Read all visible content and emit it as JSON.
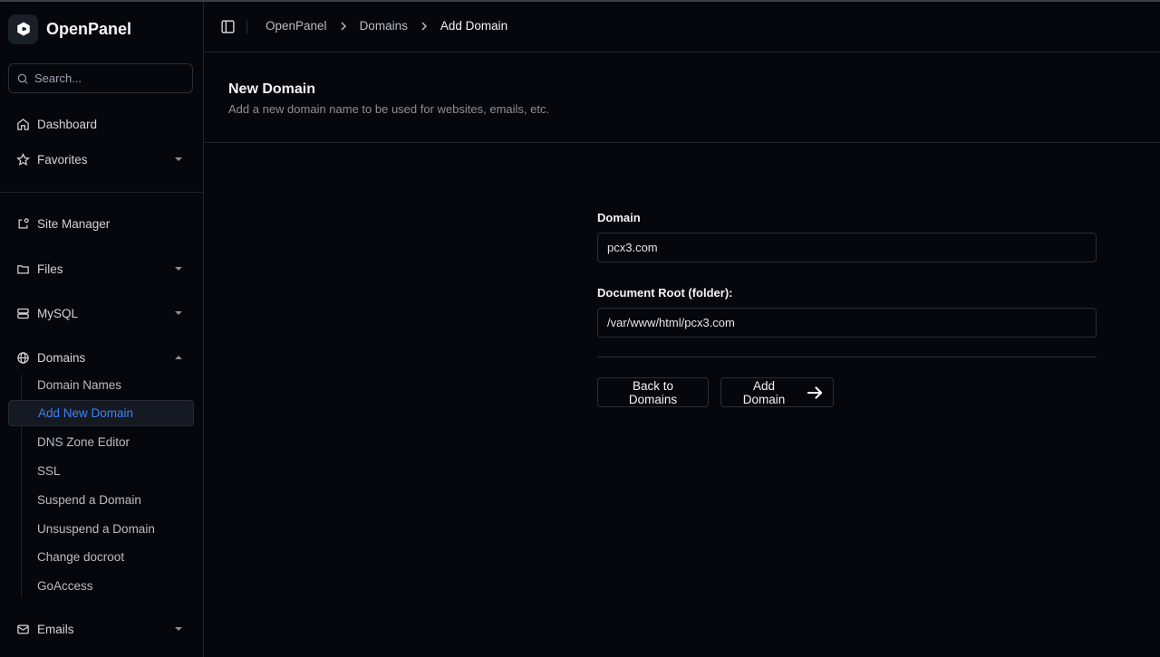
{
  "app": {
    "name": "OpenPanel"
  },
  "search": {
    "placeholder": "Search..."
  },
  "sidebar": {
    "dashboard": "Dashboard",
    "favorites": "Favorites",
    "site_manager": "Site Manager",
    "files": "Files",
    "mysql": "MySQL",
    "domains": "Domains",
    "domains_sub": [
      "Domain Names",
      "Add New Domain",
      "DNS Zone Editor",
      "SSL",
      "Suspend a Domain",
      "Unsuspend a Domain",
      "Change docroot",
      "GoAccess"
    ],
    "emails": "Emails"
  },
  "breadcrumb": [
    "OpenPanel",
    "Domains",
    "Add Domain"
  ],
  "page": {
    "title": "New Domain",
    "subtitle": "Add a new domain name to be used for websites, emails, etc."
  },
  "form": {
    "domain_label": "Domain",
    "domain_value": "pcx3.com",
    "docroot_label": "Document Root (folder):",
    "docroot_value": "/var/www/html/pcx3.com",
    "back_button": "Back to Domains",
    "submit_button": "Add Domain"
  },
  "colors": {
    "accent": "#3b82f6",
    "background": "#05070d",
    "border": "#1f232b"
  }
}
